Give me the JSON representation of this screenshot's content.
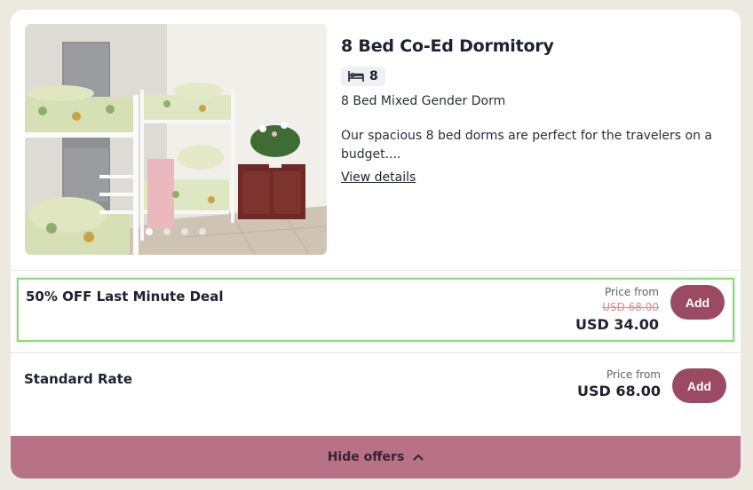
{
  "room": {
    "title": "8 Bed Co-Ed Dormitory",
    "bed_count": "8",
    "subtitle": "8 Bed Mixed Gender Dorm",
    "description": "Our spacious 8 bed dorms are perfect for the travelers on a budget....",
    "view_details": "View details",
    "photo_dots": 4,
    "active_dot": 1
  },
  "offers": [
    {
      "name": "50% OFF Last Minute Deal",
      "price_from_label": "Price from",
      "old_price": "USD 68.00",
      "price": "USD 34.00",
      "button": "Add",
      "highlighted": true
    },
    {
      "name": "Standard Rate",
      "price_from_label": "Price from",
      "price": "USD 68.00",
      "button": "Add",
      "highlighted": false
    }
  ],
  "footer": {
    "label": "Hide offers",
    "icon": "chevron-up-icon"
  },
  "colors": {
    "accent": "#9b4a63",
    "footer_bg": "#b77287",
    "highlight_border": "#8fd67f",
    "old_price": "#e6868a",
    "page_bg": "#ece9e1"
  }
}
